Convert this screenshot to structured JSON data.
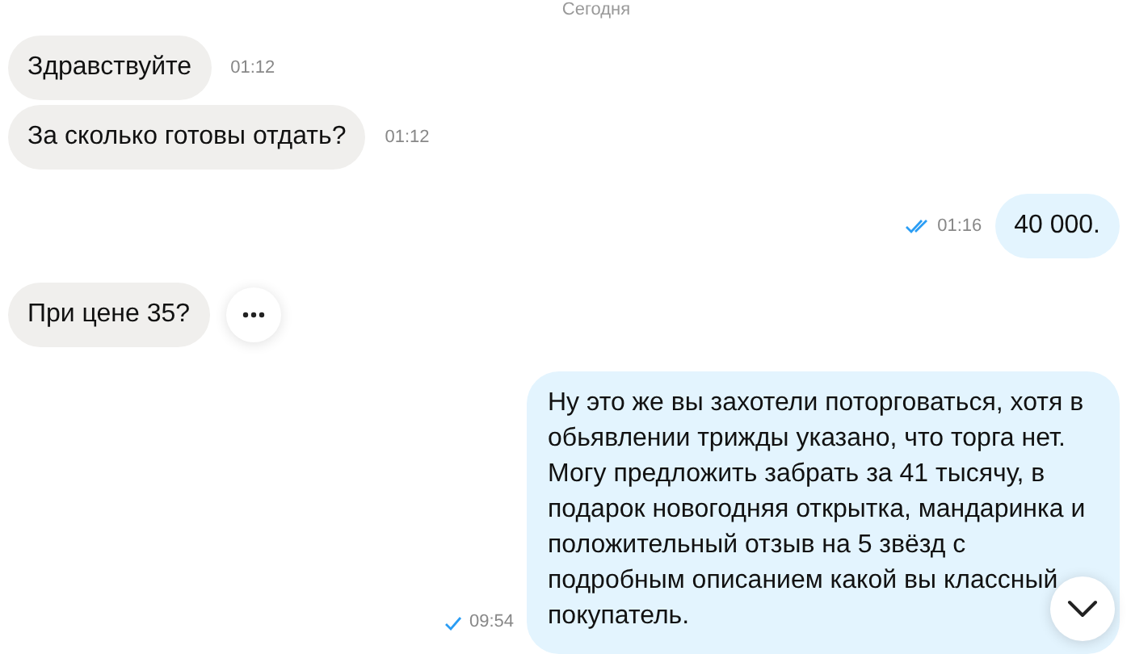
{
  "date_label": "Сегодня",
  "messages": [
    {
      "kind": "incoming",
      "text": "Здравствуйте",
      "time": "01:12",
      "has_menu": false
    },
    {
      "kind": "incoming",
      "text": "За сколько готовы отдать?",
      "time": "01:12",
      "has_menu": false
    },
    {
      "kind": "outgoing",
      "text": "40 000.",
      "time": "01:16",
      "read": true
    },
    {
      "kind": "incoming",
      "text": "При цене 35?",
      "has_menu": true
    },
    {
      "kind": "outgoing",
      "text": "Ну это же вы захотели поторговаться, хотя в обьявлении трижды указано, что торга нет. Могу предложить забрать за 41 тысячу, в подарок новогодняя открытка, мандаринка и положительный отзыв на 5 звёзд с подробным описанием какой вы классный покупатель.",
      "time": "09:54",
      "read": false
    }
  ]
}
